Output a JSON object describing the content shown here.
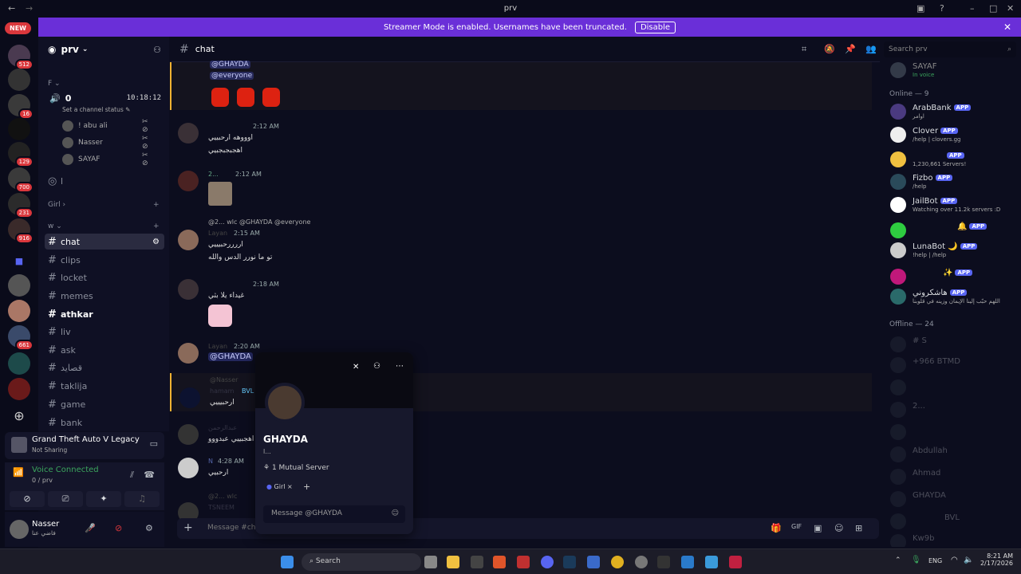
{
  "window": {
    "title": "prv"
  },
  "banner": {
    "text": "Streamer Mode is enabled. Usernames have been truncated.",
    "button": "Disable"
  },
  "servers": {
    "new_label": "NEW",
    "badges": [
      "512",
      "16",
      "129",
      "700",
      "231",
      "916",
      "661"
    ]
  },
  "guild": {
    "name": "prv"
  },
  "sidebar": {
    "cat_f": "F",
    "voice_channel": "0",
    "voice_timer": "10:18:12",
    "voice_status": "Set a channel status",
    "voice_users": [
      "! abu ali",
      "Nasser",
      "SAYAF"
    ],
    "stage": "l",
    "cat_girl": "Girl",
    "cat_w": "w",
    "channels": [
      "chat",
      "clips",
      "locket",
      "memes",
      "athkar",
      "liv",
      "ask",
      "قصايد",
      "taklija",
      "game",
      "bank"
    ]
  },
  "activity": {
    "game": "Grand Theft Auto V Legacy",
    "status": "Not Sharing"
  },
  "voice": {
    "label": "Voice Connected",
    "channel": "0 / prv"
  },
  "user": {
    "name": "Nasser",
    "status": "فاضي عنا"
  },
  "chat": {
    "channel": "chat",
    "search_placeholder": "Search prv",
    "composer_placeholder": "Message #ch",
    "messages": [
      {
        "name": "",
        "time": "",
        "lines": [
          "@GHAYDA",
          "@everyone"
        ]
      },
      {
        "name": "",
        "time": "2:12 AM",
        "lines": [
          "اوووهه ارحبييي",
          "اهجبجبجبيي"
        ]
      },
      {
        "name": "2...",
        "time": "2:12 AM",
        "lines": []
      },
      {
        "name": "Layan",
        "time": "2:15 AM",
        "reply": "@2... wlc @GHAYDA @everyone",
        "lines": [
          "اررررحبيييي",
          "تو ما نورر الدس والله"
        ]
      },
      {
        "name": "",
        "time": "2:18 AM",
        "lines": [
          "غيداء يلا بثي"
        ]
      },
      {
        "name": "Layan",
        "time": "2:20 AM",
        "lines": [
          "@GHAYDA"
        ]
      },
      {
        "name": "hamam",
        "time": "",
        "reply": "@Nasser",
        "tag": "BVL",
        "lines": [
          "ارحبيييي"
        ]
      },
      {
        "name": "عبدالرحمن",
        "time": "",
        "lines": [
          "اهجبييي عبدووو"
        ]
      },
      {
        "name": "N",
        "time": "4:28 AM",
        "lines": [
          "ارحبيي"
        ]
      },
      {
        "name": "TSNEEM",
        "time": "",
        "reply": "@2... wlc",
        "lines": []
      }
    ]
  },
  "members": {
    "top": {
      "name": "SAYAF",
      "status": "In voice"
    },
    "online_header": "Online — 9",
    "offline_header": "Offline — 24",
    "app_label": "APP",
    "online": [
      {
        "name": "ArabBank",
        "status": "اوامر"
      },
      {
        "name": "Clover",
        "status": "/help | clovers.gg"
      },
      {
        "name": "",
        "status": "1,230,661 Servers!"
      },
      {
        "name": "Fizbo",
        "status": "/help"
      },
      {
        "name": "JailBot",
        "status": "Watching over 11.2k servers :D"
      },
      {
        "name": "",
        "status": ""
      },
      {
        "name": "LunaBot 🌙",
        "status": "!help | /help"
      },
      {
        "name": "",
        "status": ""
      },
      {
        "name": "هاشكروني",
        "status": "اللهم حبّب إلينا الإيمان وزينه في قلوبنا"
      }
    ],
    "offline": [
      "# S",
      "+966 BTMD",
      "",
      "2...",
      "",
      "Abdullah",
      "Ahmad",
      "GHAYDA",
      "",
      "BVL",
      "Kw9b"
    ]
  },
  "popout": {
    "name": "GHAYDA",
    "sub": "l...",
    "mutual": "1 Mutual Server",
    "role": "Girl",
    "message_placeholder": "Message @GHAYDA"
  },
  "taskbar": {
    "search": "Search",
    "lang": "ENG",
    "time": "8:21 AM",
    "date": "2/17/2026"
  }
}
